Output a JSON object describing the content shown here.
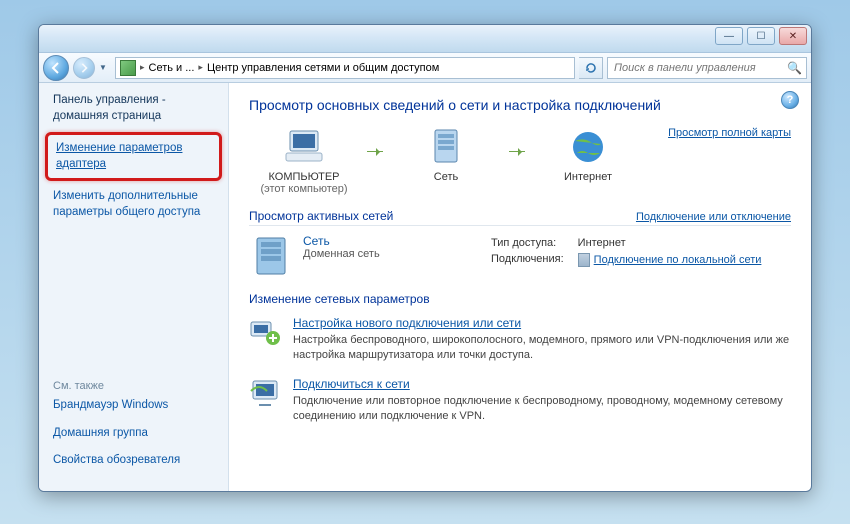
{
  "titlebar": {
    "min": "—",
    "max": "☐",
    "close": "✕"
  },
  "nav": {
    "crumb1": "Сеть и ...",
    "crumb2": "Центр управления сетями и общим доступом",
    "search_placeholder": "Поиск в панели управления"
  },
  "sidebar": {
    "home": "Панель управления - домашняя страница",
    "adapter": "Изменение параметров адаптера",
    "sharing": "Изменить дополнительные параметры общего доступа",
    "see_also": "См. также",
    "firewall": "Брандмауэр Windows",
    "homegroup": "Домашняя группа",
    "observer": "Свойства обозревателя"
  },
  "main": {
    "title": "Просмотр основных сведений о сети и настройка подключений",
    "full_map": "Просмотр полной карты",
    "node_computer": "КОМПЬЮТЕР",
    "node_computer_sub": "(этот компьютер)",
    "node_network": "Сеть",
    "node_internet": "Интернет",
    "active_title": "Просмотр активных сетей",
    "active_link": "Подключение или отключение",
    "net_name": "Сеть",
    "net_type": "Доменная сеть",
    "access_label": "Тип доступа:",
    "access_value": "Интернет",
    "conn_label": "Подключения:",
    "conn_value": "Подключение по локальной сети",
    "change_title": "Изменение сетевых параметров",
    "task1_title": "Настройка нового подключения или сети",
    "task1_desc": "Настройка беспроводного, широкополосного, модемного, прямого или VPN-подключения или же настройка маршрутизатора или точки доступа.",
    "task2_title": "Подключиться к сети",
    "task2_desc": "Подключение или повторное подключение к беспроводному, проводному, модемному сетевому соединению или подключение к VPN."
  }
}
